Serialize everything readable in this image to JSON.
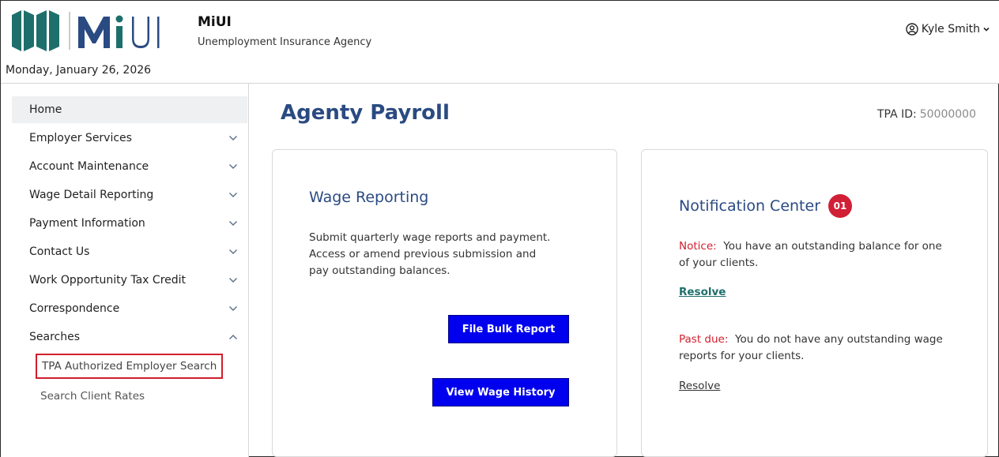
{
  "header": {
    "logo_text": "MiUI",
    "agency_name": "MiUI",
    "agency_subtitle": "Unemployment Insurance Agency",
    "date": "Monday, January 26, 2026",
    "user_name": "Kyle Smith",
    "colors": {
      "logo_teal": "#1e6f6b",
      "logo_navy": "#2a4a82"
    }
  },
  "sidebar": {
    "items": [
      {
        "label": "Home",
        "active": true
      },
      {
        "label": "Employer Services",
        "expanded": false
      },
      {
        "label": "Account Maintenance",
        "expanded": false
      },
      {
        "label": "Wage Detail Reporting",
        "expanded": false
      },
      {
        "label": "Payment Information",
        "expanded": false
      },
      {
        "label": "Contact Us",
        "expanded": false
      },
      {
        "label": "Work Opportunity Tax Credit",
        "expanded": false
      },
      {
        "label": "Correspondence",
        "expanded": false
      },
      {
        "label": "Searches",
        "expanded": true
      }
    ],
    "sub_items": [
      {
        "label": "TPA Authorized Employer Search",
        "highlighted": true
      },
      {
        "label": "Search Client Rates"
      }
    ]
  },
  "main": {
    "title": "Agenty Payroll",
    "tpa_label": "TPA ID:",
    "tpa_value": "50000000",
    "wage_card": {
      "title": "Wage Reporting",
      "description": "Submit quarterly wage reports and payment. Access or amend previous submission and pay outstanding balances.",
      "btn_bulk": "File Bulk Report",
      "btn_history": "View Wage History"
    },
    "notification_card": {
      "title": "Notification Center",
      "badge": "01",
      "notice_lead": "Notice:",
      "notice_text": "You have an outstanding balance for one of your clients.",
      "resolve1": "Resolve",
      "pastdue_lead": "Past due:",
      "pastdue_text": "You do not have any outstanding wage reports for your clients.",
      "resolve2": "Resolve"
    }
  }
}
